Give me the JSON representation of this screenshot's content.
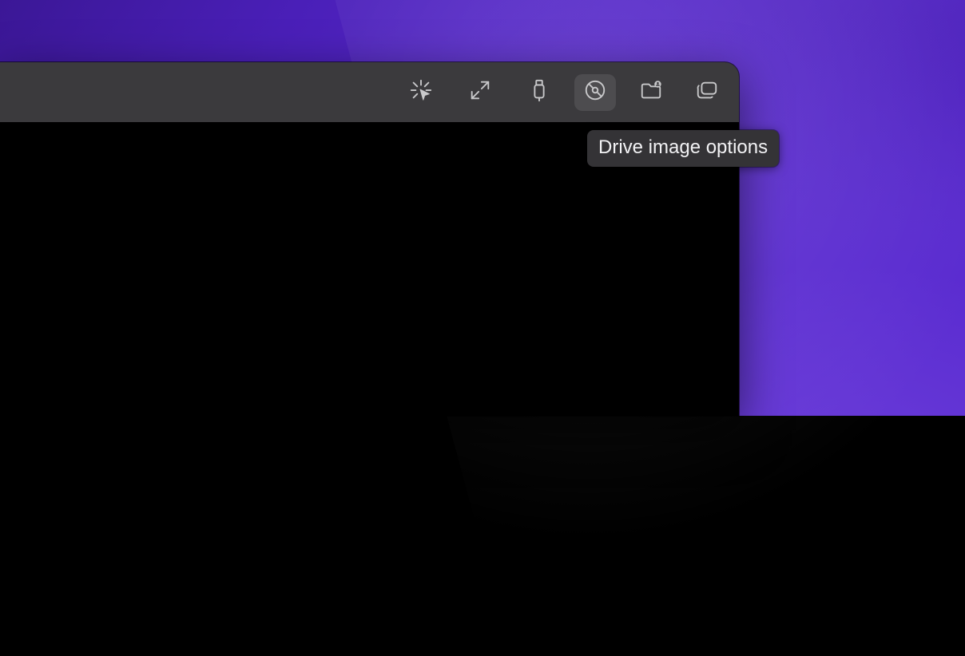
{
  "toolbar": {
    "buttons": {
      "capture_cursor": {
        "name": "capture-cursor-button"
      },
      "resize": {
        "name": "resize-button"
      },
      "usb": {
        "name": "usb-options-button"
      },
      "drive_image": {
        "name": "drive-image-options-button",
        "active": true
      },
      "shared_folder": {
        "name": "shared-folder-button"
      },
      "windows": {
        "name": "display-options-button"
      }
    }
  },
  "tooltip": {
    "text": "Drive image options"
  }
}
